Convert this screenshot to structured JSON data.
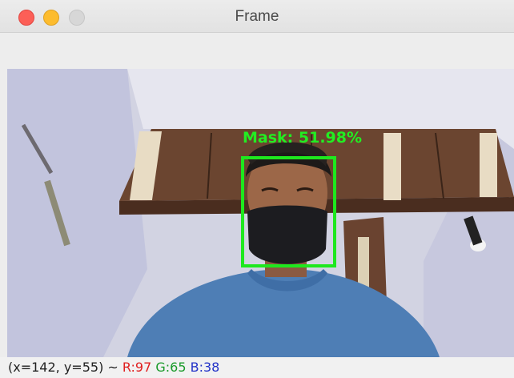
{
  "window": {
    "title": "Frame",
    "buttons": {
      "close": "close-button",
      "minimize": "minimize-button",
      "maximize": "maximize-button"
    }
  },
  "detection": {
    "label": "Mask: 51.98%",
    "box_color": "#1ee81e"
  },
  "status": {
    "coords": "(x=142, y=55) ~",
    "r": "R:97",
    "g": "G:65",
    "b": "B:38"
  }
}
